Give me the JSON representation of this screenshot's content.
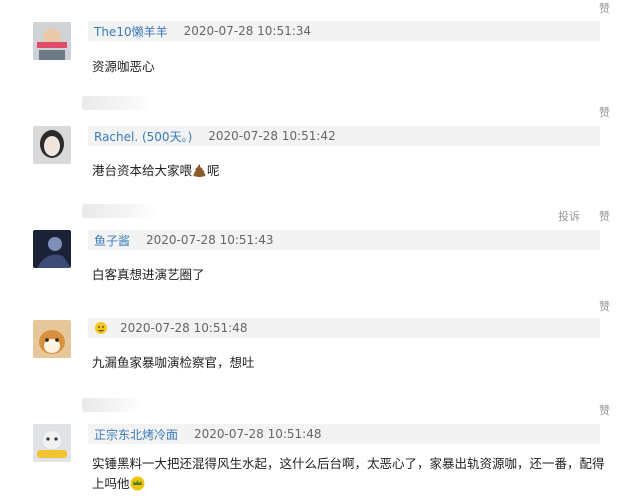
{
  "like_label": "赞",
  "report_label": "投诉",
  "comments": [
    {
      "user": "The10懒羊羊",
      "time": "2020-07-28 10:51:34",
      "text": "资源咖恶心"
    },
    {
      "user": "Rachel. (500天。)",
      "time": "2020-07-28 10:51:42",
      "text_before": "港台资本给大家喂",
      "text_after": "呢",
      "emoji": "poop-emoji"
    },
    {
      "user": "鱼子酱",
      "time": "2020-07-28 10:51:43",
      "text": "白客真想进演艺圈了"
    },
    {
      "user": "",
      "user_icon": "face-emoji",
      "time": "2020-07-28 10:51:48",
      "text": "九漏鱼家暴咖演检察官，想吐"
    },
    {
      "user": "正宗东北烤冷面",
      "time": "2020-07-28 10:51:48",
      "text": "实锤黑料一大把还混得风生水起，这什么后台啊，太恶心了，家暴出轨资源咖，还一番，配得上吗他",
      "emoji": "crown-emoji"
    }
  ]
}
